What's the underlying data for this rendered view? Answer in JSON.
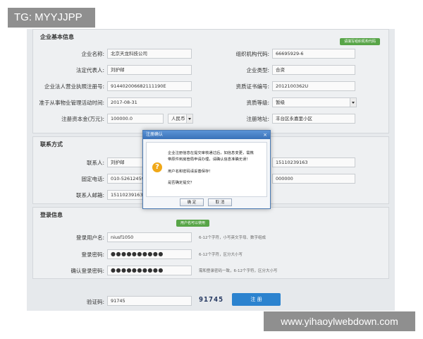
{
  "overlay_tag": "TG: MYYJJPP",
  "watermark": "www.yihaoylwebdown.com",
  "company_section": {
    "title": "企业基本信息",
    "tip": "请填写组织机构代码",
    "fields": [
      {
        "label": "企业名称:",
        "value": "北京天龙科技公司"
      },
      {
        "label": "法定代表人:",
        "value": "刘护邮"
      },
      {
        "label": "企业法人营业执照注册号:",
        "value": "914402006682111190E"
      },
      {
        "label": "准于从事物业管理活动时间:",
        "value": "2017-08-31"
      },
      {
        "label": "注册资本金(万元):",
        "value": "100000.0",
        "unit": "人民币"
      },
      {
        "label": "组织机构代码:",
        "value": "66695929-6"
      },
      {
        "label": "企业类型:",
        "value": "合资"
      },
      {
        "label": "资质证书编号:",
        "value": "2012100362U"
      },
      {
        "label": "资质等级:",
        "value": "暂级"
      },
      {
        "label": "注册地址:",
        "value": "丰台区永嘉里小区"
      }
    ]
  },
  "contact_section": {
    "title": "联系方式",
    "fields": [
      {
        "label": "联系人:",
        "value": "刘护邮"
      },
      {
        "label": "固定电话:",
        "value": "010-52612459"
      },
      {
        "label": "联系人邮箱:",
        "value": "15110239163@"
      },
      {
        "label": "",
        "value": "15110239163"
      },
      {
        "label": "",
        "value": "000000"
      }
    ]
  },
  "login_section": {
    "title": "登录信息",
    "tip": "用户名可以使用",
    "fields": [
      {
        "label": "登录用户名:",
        "value": "niusf1050",
        "hint": "6-12个字符，小写英文字母、数字组成"
      },
      {
        "label": "登录密码:",
        "value": "●●●●●●●●●●",
        "hint": "6-12个字符，区分大小写"
      },
      {
        "label": "确认登录密码:",
        "value": "●●●●●●●●●●",
        "hint": "需和登录密码一致，6-12个字符，区分大小写"
      }
    ]
  },
  "captcha": {
    "label": "验证码:",
    "value": "91745",
    "image_text": "91745"
  },
  "register_button": "注 册",
  "dialog": {
    "title": "注册确认",
    "close": "×",
    "lines": [
      "企业注册信息在提交审核通过后，如信息变更，需携",
      "带原件到房管局申请办理，请确认信息准确无误！",
      "用户名和密码请妥善保存！",
      "是否确定提交？"
    ],
    "ok": "确 定",
    "cancel": "取 消"
  },
  "colors": {
    "accent": "#2c83cf",
    "tip_green": "#58a548",
    "warning": "#f0a818"
  }
}
